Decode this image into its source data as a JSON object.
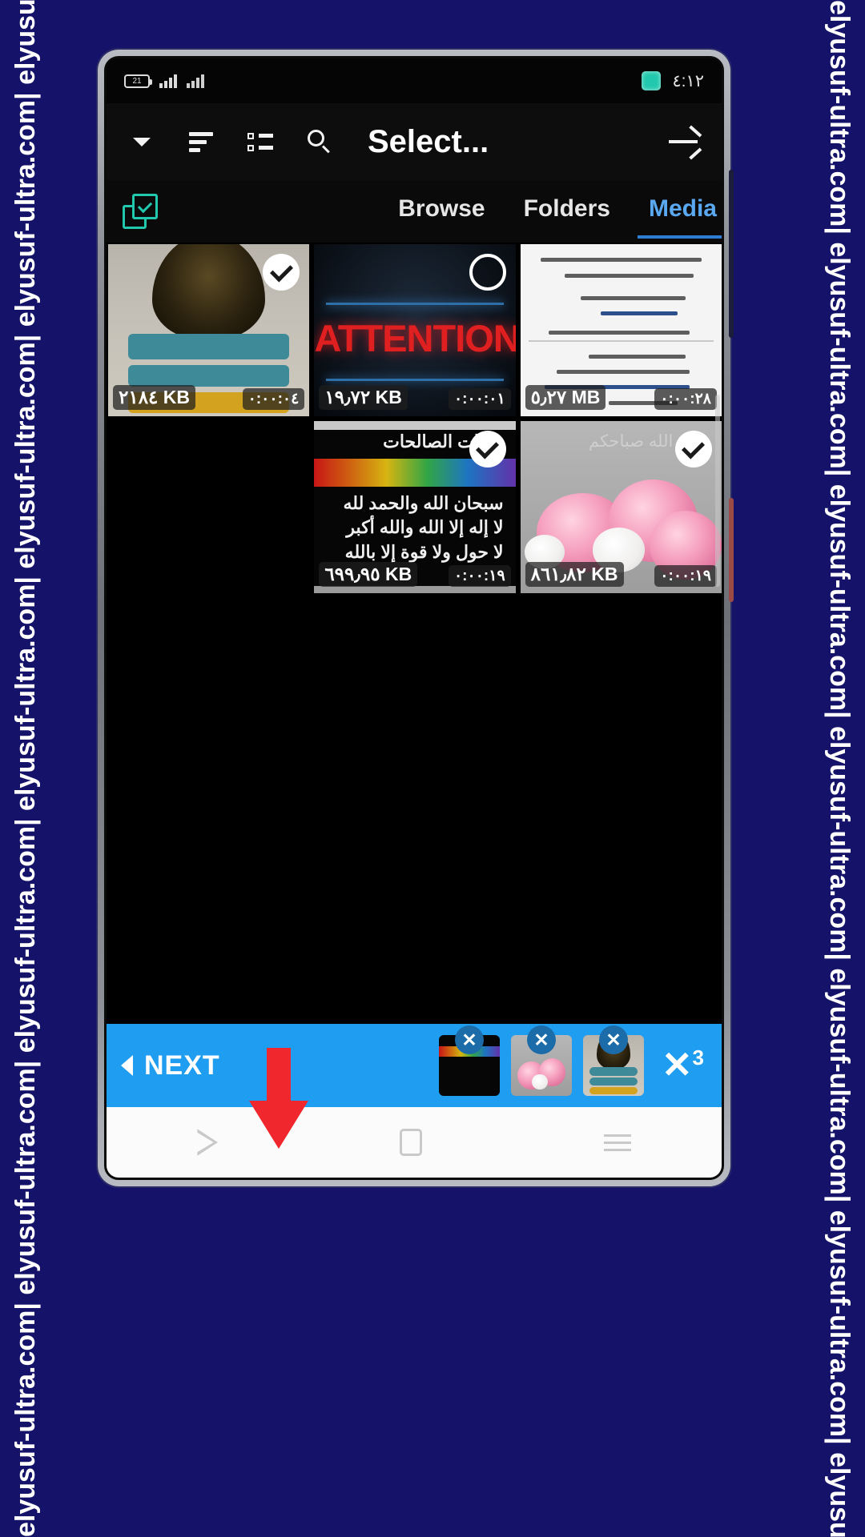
{
  "watermark": {
    "text": "elyusuf-ultra.com| elyusuf-ultra.com| elyusuf-ultra.com| elyusuf-ultra.com| elyusuf-ultra.com| elyusuf-ultra.com| elyusuf-ultra.com| elyusuf-ultra.com|",
    "color": "#ffffff",
    "background": "#151369"
  },
  "status_bar": {
    "battery_text": "21",
    "signal_icon": "signal-bars-icon",
    "signal_icon_2": "signal-bars-secondary-icon",
    "app_icon": "app-indicator-icon",
    "clock": "٤:١٢"
  },
  "toolbar": {
    "dropdown_icon": "chevron-down-icon",
    "sort_icon": "sort-icon",
    "list_icon": "list-view-icon",
    "search_icon": "search-icon",
    "title": "Select...",
    "forward_icon": "arrow-right-icon"
  },
  "tabs_row": {
    "select_all_icon": "select-multiple-icon",
    "select_all_color": "#22c8ae",
    "active_color": "#5aa9f0",
    "tabs": [
      {
        "label": "Browse",
        "active": false
      },
      {
        "label": "Folders",
        "active": false
      },
      {
        "label": "Media",
        "active": true
      }
    ]
  },
  "media_grid": {
    "items": [
      {
        "art": "poster",
        "size": "٢١٨٤ KB",
        "duration": "٠:٠٠:٠٤",
        "selected": true,
        "check_state": "checked"
      },
      {
        "art": "attention",
        "art_text": "ATTENTION",
        "size": "١٩٫٧٢ KB",
        "duration": "٠:٠٠:٠١",
        "selected": false,
        "check_state": "unchecked"
      },
      {
        "art": "document",
        "size": "٥٫٢٧ MB",
        "duration": "٠:٠٠:٢٨",
        "selected": false,
        "check_state": "none"
      },
      {
        "art": "empty",
        "size": "",
        "duration": "",
        "selected": false,
        "check_state": "none"
      },
      {
        "art": "dhikr",
        "art_line_1": "باقيات الصالحات",
        "art_line_2": "سبحان الله والحمد لله",
        "art_line_3": "لا إله إلا الله والله أكبر",
        "art_line_4": "لا حول ولا قوة إلا بالله",
        "size": "٦٩٩٫٩٥ KB",
        "duration": "٠:٠٠:١٩",
        "selected": true,
        "check_state": "checked"
      },
      {
        "art": "roses",
        "art_text": "بارك الله صباحكم",
        "size": "٨٦١٫٨٢ KB",
        "duration": "٠:٠٠:١٩",
        "selected": true,
        "check_state": "checked"
      }
    ]
  },
  "bottom_bar": {
    "background": "#1f9df0",
    "back_icon": "chevron-left-icon",
    "next_label": "NEXT",
    "selected_thumbs": [
      {
        "art": "dhikr",
        "remove_icon": "remove-x-icon",
        "remove_label": "✕"
      },
      {
        "art": "roses",
        "remove_icon": "remove-x-icon",
        "remove_label": "✕"
      },
      {
        "art": "poster",
        "remove_icon": "remove-x-icon",
        "remove_label": "✕"
      }
    ],
    "clear_all_icon": "clear-all-x-icon",
    "clear_all_symbol": "✕",
    "selected_count": "3"
  },
  "nav_bar": {
    "back_icon": "nav-back-icon",
    "home_icon": "nav-home-icon",
    "recents_icon": "nav-recents-icon"
  },
  "annotation": {
    "arrow_icon": "red-down-arrow-annotation",
    "color": "#f0282d"
  }
}
